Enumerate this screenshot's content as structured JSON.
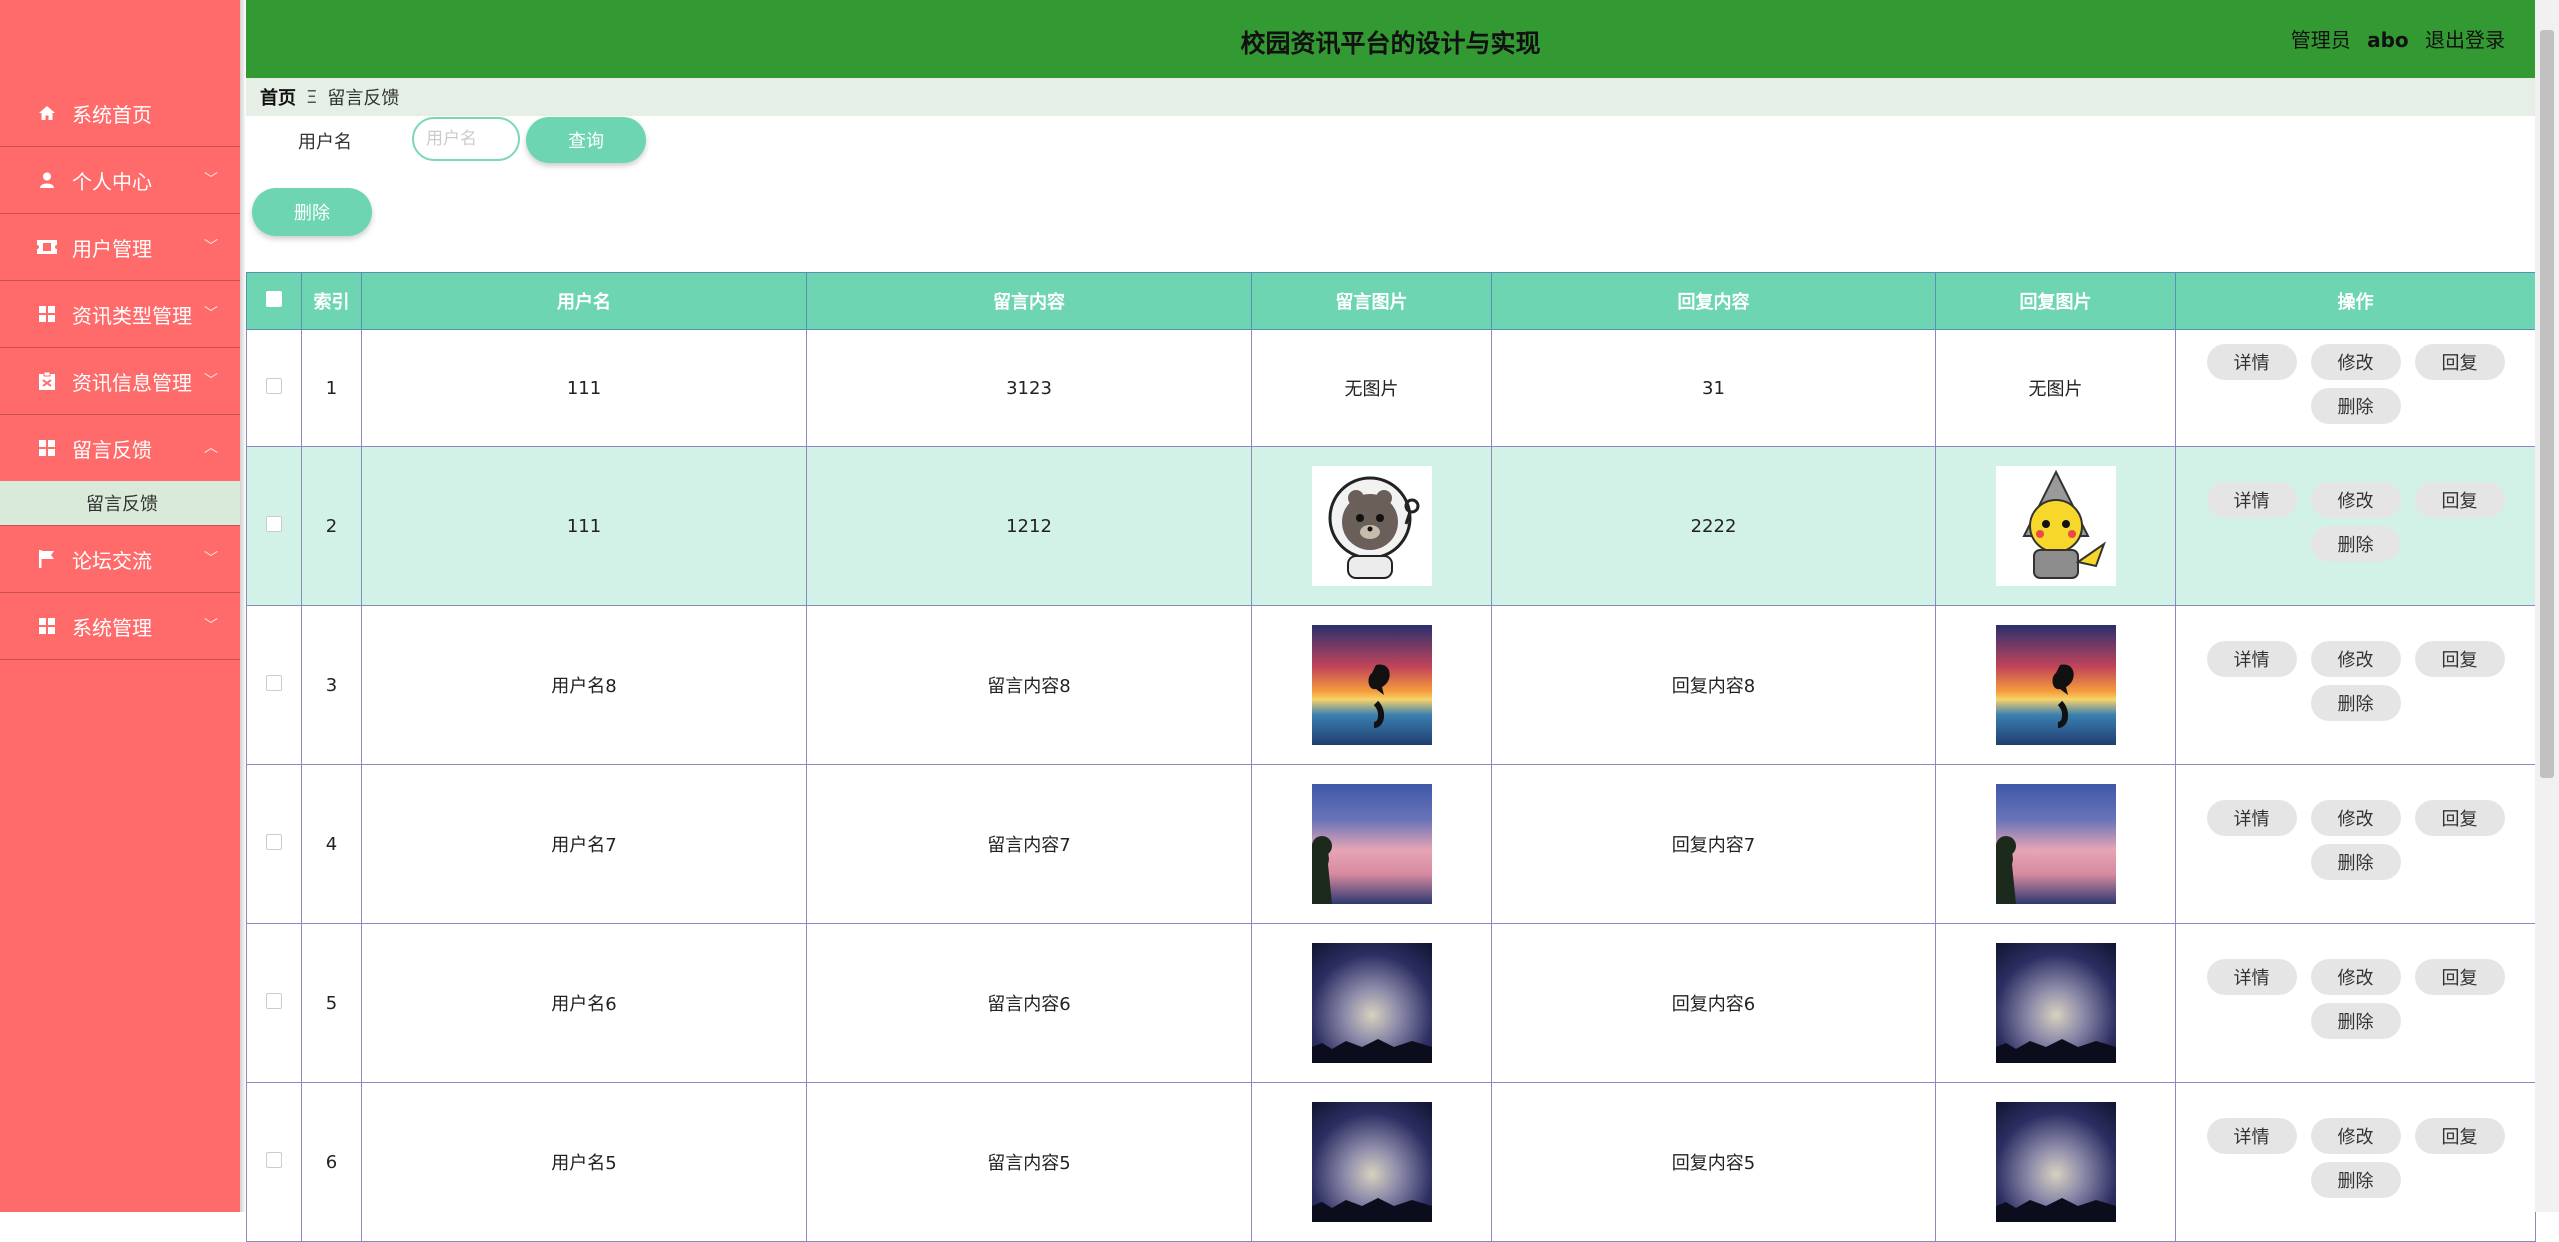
{
  "app": {
    "title": "校园资讯平台的设计与实现",
    "role": "管理员",
    "username": "abo",
    "logout": "退出登录"
  },
  "sidebar": {
    "items": [
      {
        "label": "系统首页",
        "icon": "home-icon"
      },
      {
        "label": "个人中心",
        "icon": "user-icon"
      },
      {
        "label": "用户管理",
        "icon": "ticket-icon"
      },
      {
        "label": "资讯类型管理",
        "icon": "grid-icon"
      },
      {
        "label": "资讯信息管理",
        "icon": "clipboard-icon"
      },
      {
        "label": "留言反馈",
        "icon": "grid-icon"
      },
      {
        "label": "论坛交流",
        "icon": "flag-icon"
      },
      {
        "label": "系统管理",
        "icon": "grid-icon"
      }
    ],
    "submenu": {
      "label": "留言反馈"
    }
  },
  "breadcrumb": {
    "home": "首页",
    "separator": "Ξ",
    "current": "留言反馈"
  },
  "search": {
    "label": "用户名",
    "placeholder": "用户名",
    "button": "查询"
  },
  "toolbar": {
    "delete": "删除"
  },
  "table": {
    "headers": [
      "索引",
      "用户名",
      "留言内容",
      "留言图片",
      "回复内容",
      "回复图片",
      "操作"
    ],
    "rows": [
      {
        "index": "1",
        "username": "111",
        "content": "3123",
        "image": "无图片",
        "reply": "31",
        "reply_image": "无图片"
      },
      {
        "index": "2",
        "username": "111",
        "content": "1212",
        "image": "astronaut-bear",
        "reply": "2222",
        "reply_image": "pikachu-hood"
      },
      {
        "index": "3",
        "username": "用户名8",
        "content": "留言内容8",
        "image": "sunset-dolphin",
        "reply": "回复内容8",
        "reply_image": "sunset-dolphin"
      },
      {
        "index": "4",
        "username": "用户名7",
        "content": "留言内容7",
        "image": "pink-clouds",
        "reply": "回复内容7",
        "reply_image": "pink-clouds"
      },
      {
        "index": "5",
        "username": "用户名6",
        "content": "留言内容6",
        "image": "night-sky",
        "reply": "回复内容6",
        "reply_image": "night-sky"
      },
      {
        "index": "6",
        "username": "用户名5",
        "content": "留言内容5",
        "image": "night-sky",
        "reply": "回复内容5",
        "reply_image": "night-sky"
      }
    ],
    "actions": {
      "detail": "详情",
      "edit": "修改",
      "reply": "回复",
      "delete": "删除"
    }
  },
  "colors": {
    "sidebar": "#ff6b6b",
    "topbar": "#339933",
    "accent": "#6dd5b1",
    "highlight_row": "#d2f2e8"
  }
}
